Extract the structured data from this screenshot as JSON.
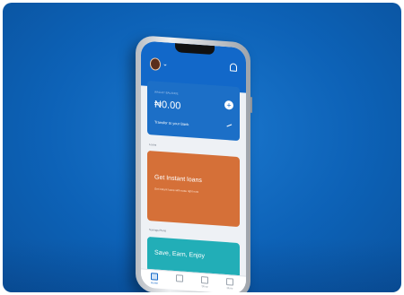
{
  "balance_card": {
    "caption": "WALLET BALANCE",
    "amount": "₦0.00",
    "action": "Transfer to your Bank",
    "add_icon": "plus-icon"
  },
  "loans": {
    "section_label": "Loans",
    "title": "Get Instant loans",
    "subtitle": "Get instant loans with ease right now"
  },
  "savings": {
    "section_label": "Savings Plans",
    "title": "Save, Earn, Enjoy"
  },
  "tabs": [
    {
      "label": "Home",
      "icon": "home-icon"
    },
    {
      "label": "",
      "icon": "card-icon"
    },
    {
      "label": "Shop",
      "icon": "shop-icon"
    },
    {
      "label": "More",
      "icon": "grid-icon"
    }
  ],
  "colors": {
    "background": "#0d62b7",
    "topbar": "#1268c9",
    "loans_card": "#d57038",
    "savings_card": "#22aeb7"
  }
}
